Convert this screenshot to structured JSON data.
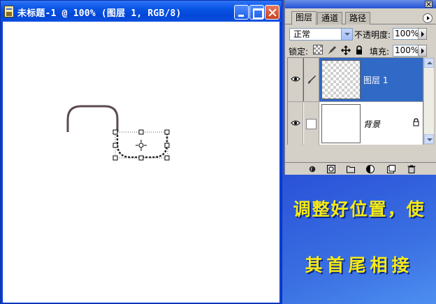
{
  "window": {
    "title": "未标题-1 @ 100% (图层 1, RGB/8)"
  },
  "layers_panel": {
    "tabs": [
      {
        "label": "图层",
        "active": true
      },
      {
        "label": "通道",
        "active": false
      },
      {
        "label": "路径",
        "active": false
      }
    ],
    "blend_mode": "正常",
    "opacity_label": "不透明度:",
    "opacity_value": "100%",
    "lock_label": "锁定:",
    "fill_label": "填充:",
    "fill_value": "100%",
    "layers": [
      {
        "name": "图层 1",
        "selected": true,
        "visible": true
      },
      {
        "name": "背景",
        "selected": false,
        "visible": true,
        "locked": true
      }
    ]
  },
  "instruction": {
    "line1": "调整好位置，使",
    "line2": "其首尾相接"
  },
  "colors": {
    "xp_title_blue": "#0a56e6",
    "selected_layer": "#3169c6",
    "instruction_text": "#f6ea15",
    "panel_gray": "#d4d0c8"
  },
  "icons": [
    "document-icon",
    "minimize-icon",
    "maximize-icon",
    "close-icon",
    "eye-icon",
    "brush-icon",
    "move-icon",
    "lock-icon",
    "link-icon",
    "new-layer-icon",
    "trash-icon"
  ]
}
